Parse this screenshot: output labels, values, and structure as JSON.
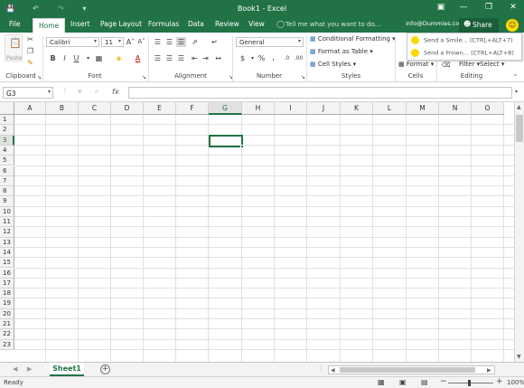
{
  "window": {
    "title": "Book1 - Excel"
  },
  "tabs": [
    "File",
    "Home",
    "Insert",
    "Page Layout",
    "Formulas",
    "Data",
    "Review",
    "View"
  ],
  "tell_me": "Tell me what you want to do...",
  "user": "info@Dummies.com",
  "share": "Share",
  "ribbon": {
    "clipboard": {
      "label": "Clipboard",
      "paste": "Paste"
    },
    "font": {
      "label": "Font",
      "name": "Calibri",
      "size": "11"
    },
    "alignment": {
      "label": "Alignment"
    },
    "number": {
      "label": "Number",
      "format": "General"
    },
    "styles": {
      "label": "Styles",
      "conditional": "Conditional Formatting",
      "format_table": "Format as Table",
      "cell_styles": "Cell Styles"
    },
    "cells": {
      "label": "Cells",
      "format": "Format"
    },
    "editing": {
      "label": "Editing",
      "filter": "Filter",
      "select": "Select"
    }
  },
  "feedback": {
    "smile": "Send a Smile... (CTRL+ALT+7)",
    "frown": "Send a Frown... (CTRL+ALT+8)"
  },
  "formula_bar": {
    "name_box": "G3",
    "fx": "fx"
  },
  "columns": [
    "A",
    "B",
    "C",
    "D",
    "E",
    "F",
    "G",
    "H",
    "I",
    "J",
    "K",
    "L",
    "M",
    "N",
    "O"
  ],
  "rows": [
    "1",
    "2",
    "3",
    "4",
    "5",
    "6",
    "7",
    "8",
    "9",
    "10",
    "11",
    "12",
    "13",
    "14",
    "15",
    "16",
    "17",
    "18",
    "19",
    "20",
    "21",
    "22",
    "23"
  ],
  "active_cell": {
    "col": "G",
    "row": "3"
  },
  "sheet": {
    "name": "Sheet1"
  },
  "status": {
    "left": "Ready",
    "zoom": "100%"
  },
  "colors": {
    "brand": "#217346"
  }
}
